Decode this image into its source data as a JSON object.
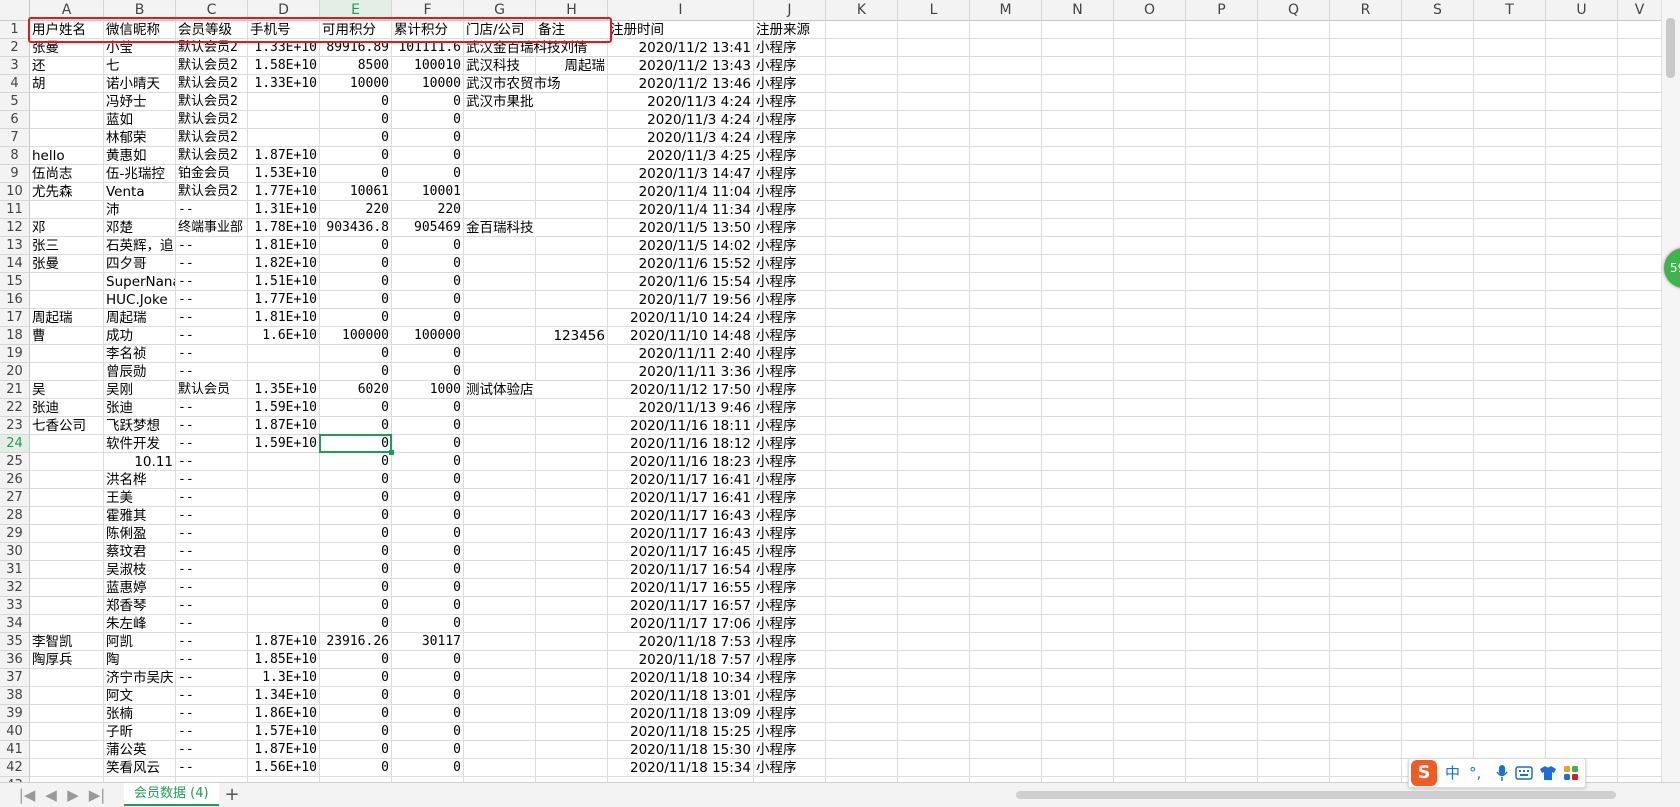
{
  "columns": [
    "A",
    "B",
    "C",
    "D",
    "E",
    "F",
    "G",
    "H",
    "I",
    "J",
    "K",
    "L",
    "M",
    "N",
    "O",
    "P",
    "Q",
    "R",
    "S",
    "T",
    "U",
    "V"
  ],
  "selected_column": "E",
  "selected_row": "24",
  "header_row": [
    "用户姓名",
    "微信昵称",
    "会员等级",
    "手机号",
    "可用积分",
    "累计积分",
    "门店/公司",
    "备注",
    "注册时间",
    "注册来源"
  ],
  "rows": [
    [
      "张曼",
      "小莹",
      "默认会员2",
      "1.33E+10",
      "89916.89",
      "101111.6",
      "武汉金百瑞科技刘倩",
      "",
      "2020/11/2 13:41",
      "小程序"
    ],
    [
      "还",
      "七",
      "默认会员2",
      "1.58E+10",
      "8500",
      "100010",
      "武汉科技",
      "周起瑞",
      "2020/11/2 13:43",
      "小程序"
    ],
    [
      "胡",
      "诺小晴天",
      "默认会员2",
      "1.33E+10",
      "10000",
      "10000",
      "武汉市农贸市场",
      "",
      "2020/11/2 13:46",
      "小程序"
    ],
    [
      "",
      "冯妤士",
      "默认会员2",
      "",
      "0",
      "0",
      "武汉市果批",
      "",
      "2020/11/3 4:24",
      "小程序"
    ],
    [
      "",
      "蓝如",
      "默认会员2",
      "",
      "0",
      "0",
      "",
      "",
      "2020/11/3 4:24",
      "小程序"
    ],
    [
      "",
      "林郁荣",
      "默认会员2",
      "",
      "0",
      "0",
      "",
      "",
      "2020/11/3 4:24",
      "小程序"
    ],
    [
      "hello",
      "黄惠如",
      "默认会员2",
      "1.87E+10",
      "0",
      "0",
      "",
      "",
      "2020/11/3 4:25",
      "小程序"
    ],
    [
      "伍尚志",
      "伍-兆瑞控",
      "铂金会员",
      "1.53E+10",
      "0",
      "0",
      "",
      "",
      "2020/11/3 14:47",
      "小程序"
    ],
    [
      "尤先森",
      "Venta",
      "默认会员2",
      "1.77E+10",
      "10061",
      "10001",
      "",
      "",
      "2020/11/4 11:04",
      "小程序"
    ],
    [
      "",
      "沛",
      "--",
      "1.31E+10",
      "220",
      "220",
      "",
      "",
      "2020/11/4 11:34",
      "小程序"
    ],
    [
      "邓",
      "邓楚",
      "终端事业部",
      "1.78E+10",
      "903436.8",
      "905469",
      "金百瑞科技",
      "",
      "2020/11/5 13:50",
      "小程序"
    ],
    [
      "张三",
      "石英辉，追",
      "--",
      "1.81E+10",
      "0",
      "0",
      "",
      "",
      "2020/11/5 14:02",
      "小程序"
    ],
    [
      "张曼",
      "四夕哥",
      "--",
      "1.82E+10",
      "0",
      "0",
      "",
      "",
      "2020/11/6 15:52",
      "小程序"
    ],
    [
      "",
      "SuperNana",
      "--",
      "1.51E+10",
      "0",
      "0",
      "",
      "",
      "2020/11/6 15:54",
      "小程序"
    ],
    [
      "",
      "HUC.Joke",
      "--",
      "1.77E+10",
      "0",
      "0",
      "",
      "",
      "2020/11/7 19:56",
      "小程序"
    ],
    [
      "周起瑞",
      "周起瑞",
      "--",
      "1.81E+10",
      "0",
      "0",
      "",
      "",
      "2020/11/10 14:24",
      "小程序"
    ],
    [
      "曹",
      "成功",
      "--",
      "1.6E+10",
      "100000",
      "100000",
      "",
      "123456",
      "2020/11/10 14:48",
      "小程序"
    ],
    [
      "",
      "李名祯",
      "--",
      "",
      "0",
      "0",
      "",
      "",
      "2020/11/11 2:40",
      "小程序"
    ],
    [
      "",
      "曾辰勋",
      "--",
      "",
      "0",
      "0",
      "",
      "",
      "2020/11/11 3:36",
      "小程序"
    ],
    [
      "吴",
      "吴刚",
      "默认会员",
      "1.35E+10",
      "6020",
      "1000",
      "测试体验店",
      "",
      "2020/11/12 17:50",
      "小程序"
    ],
    [
      "张迪",
      "张迪",
      "--",
      "1.59E+10",
      "0",
      "0",
      "",
      "",
      "2020/11/13 9:46",
      "小程序"
    ],
    [
      "七香公司",
      "飞跃梦想",
      "--",
      "1.87E+10",
      "0",
      "0",
      "",
      "",
      "2020/11/16 18:11",
      "小程序"
    ],
    [
      "",
      "软件开发",
      "--",
      "1.59E+10",
      "0",
      "0",
      "",
      "",
      "2020/11/16 18:12",
      "小程序"
    ],
    [
      "",
      "10.11",
      "--",
      "",
      "0",
      "0",
      "",
      "",
      "2020/11/16 18:23",
      "小程序"
    ],
    [
      "",
      "洪名桦",
      "--",
      "",
      "0",
      "0",
      "",
      "",
      "2020/11/17 16:41",
      "小程序"
    ],
    [
      "",
      "王美",
      "--",
      "",
      "0",
      "0",
      "",
      "",
      "2020/11/17 16:41",
      "小程序"
    ],
    [
      "",
      "霍雅其",
      "--",
      "",
      "0",
      "0",
      "",
      "",
      "2020/11/17 16:43",
      "小程序"
    ],
    [
      "",
      "陈俐盈",
      "--",
      "",
      "0",
      "0",
      "",
      "",
      "2020/11/17 16:43",
      "小程序"
    ],
    [
      "",
      "蔡玟君",
      "--",
      "",
      "0",
      "0",
      "",
      "",
      "2020/11/17 16:45",
      "小程序"
    ],
    [
      "",
      "吴淑枝",
      "--",
      "",
      "0",
      "0",
      "",
      "",
      "2020/11/17 16:54",
      "小程序"
    ],
    [
      "",
      "蓝惠婷",
      "--",
      "",
      "0",
      "0",
      "",
      "",
      "2020/11/17 16:55",
      "小程序"
    ],
    [
      "",
      "郑香琴",
      "--",
      "",
      "0",
      "0",
      "",
      "",
      "2020/11/17 16:57",
      "小程序"
    ],
    [
      "",
      "朱左峰",
      "--",
      "",
      "0",
      "0",
      "",
      "",
      "2020/11/17 17:06",
      "小程序"
    ],
    [
      "李智凯",
      "阿凯",
      "--",
      "1.87E+10",
      "23916.26",
      "30117",
      "",
      "",
      "2020/11/18 7:53",
      "小程序"
    ],
    [
      "陶厚兵",
      "陶",
      "--",
      "1.85E+10",
      "0",
      "0",
      "",
      "",
      "2020/11/18 7:57",
      "小程序"
    ],
    [
      "",
      "济宁市吴庆",
      "--",
      "1.3E+10",
      "0",
      "0",
      "",
      "",
      "2020/11/18 10:34",
      "小程序"
    ],
    [
      "",
      "阿文",
      "--",
      "1.34E+10",
      "0",
      "0",
      "",
      "",
      "2020/11/18 13:01",
      "小程序"
    ],
    [
      "",
      "张楠",
      "--",
      "1.86E+10",
      "0",
      "0",
      "",
      "",
      "2020/11/18 13:09",
      "小程序"
    ],
    [
      "",
      "子昕",
      "--",
      "1.57E+10",
      "0",
      "0",
      "",
      "",
      "2020/11/18 15:25",
      "小程序"
    ],
    [
      "",
      "蒲公英",
      "--",
      "1.87E+10",
      "0",
      "0",
      "",
      "",
      "2020/11/18 15:30",
      "小程序"
    ],
    [
      "",
      "笑看风云",
      "--",
      "1.56E+10",
      "0",
      "0",
      "",
      "",
      "2020/11/18 15:34",
      "小程序"
    ]
  ],
  "tabs": {
    "nav_first": "|◀",
    "nav_prev": "◀",
    "nav_next": "▶",
    "nav_last": "▶|",
    "active_tab": "会员数据 (4)",
    "add": "+"
  },
  "badge": "59",
  "ime": {
    "logo": "S",
    "lang": "中",
    "punct": "°,",
    "items": [
      "mic-icon",
      "keyboard-icon",
      "shirt-icon",
      "apps-icon"
    ]
  },
  "colors": {
    "accent": "#1f9d57",
    "highlight": "#e8171d"
  }
}
